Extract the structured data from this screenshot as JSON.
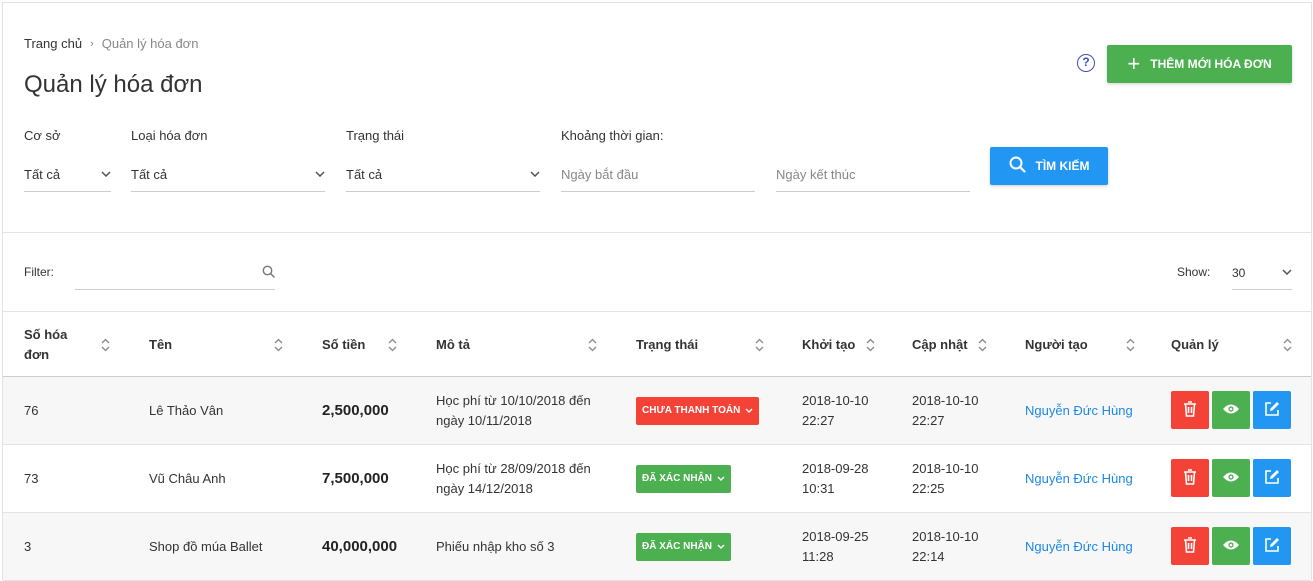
{
  "breadcrumb": {
    "home": "Trang chủ",
    "separator": "›",
    "current": "Quản lý hóa đơn"
  },
  "page_title": "Quản lý hóa đơn",
  "add_button": {
    "label": "THÊM MỚI HÓA ĐƠN",
    "icon": "plus-icon"
  },
  "help": {
    "icon": "help-circle-icon",
    "glyph": "?"
  },
  "filters": {
    "facility": {
      "label": "Cơ sở",
      "value": "Tất cả"
    },
    "invoice_type": {
      "label": "Loại hóa đơn",
      "value": "Tất cả"
    },
    "status": {
      "label": "Trạng thái",
      "value": "Tất cả"
    },
    "time_range": {
      "label": "Khoảng thời gian:",
      "start_placeholder": "Ngày bắt đầu",
      "end_placeholder": "Ngày kết thúc"
    },
    "search_button": "TÌM KIẾM"
  },
  "table_filter": {
    "label": "Filter:",
    "value": ""
  },
  "show": {
    "label": "Show:",
    "value": "30"
  },
  "columns": [
    "Số hóa đơn",
    "Tên",
    "Số tiền",
    "Mô tả",
    "Trạng thái",
    "Khởi tạo",
    "Cập nhật",
    "Người tạo",
    "Quản lý"
  ],
  "rows": [
    {
      "id": "76",
      "name": "Lê Thảo Vân",
      "amount": "2,500,000",
      "desc": "Học phí từ 10/10/2018 đến ngày 10/11/2018",
      "status": "CHƯA THANH TOÁN",
      "status_color": "#f44336",
      "created_date": "2018-10-10",
      "created_time": "22:27",
      "updated_date": "2018-10-10",
      "updated_time": "22:27",
      "creator": "Nguyễn Đức Hùng"
    },
    {
      "id": "73",
      "name": "Vũ Châu Anh",
      "amount": "7,500,000",
      "desc": "Học phí từ 28/09/2018 đến ngày 14/12/2018",
      "status": "ĐÃ XÁC NHẬN",
      "status_color": "#4caf50",
      "created_date": "2018-09-28",
      "created_time": "10:31",
      "updated_date": "2018-10-10",
      "updated_time": "22:25",
      "creator": "Nguyễn Đức Hùng"
    },
    {
      "id": "3",
      "name": "Shop đồ múa Ballet",
      "amount": "40,000,000",
      "desc": "Phiếu nhập kho số 3",
      "status": "ĐÃ XÁC NHẬN",
      "status_color": "#4caf50",
      "created_date": "2018-09-25",
      "created_time": "11:28",
      "updated_date": "2018-10-10",
      "updated_time": "22:14",
      "creator": "Nguyễn Đức Hùng"
    }
  ],
  "colors": {
    "primary": "#2196f3",
    "success": "#4caf50",
    "danger": "#f44336",
    "link": "#1e88e5"
  }
}
